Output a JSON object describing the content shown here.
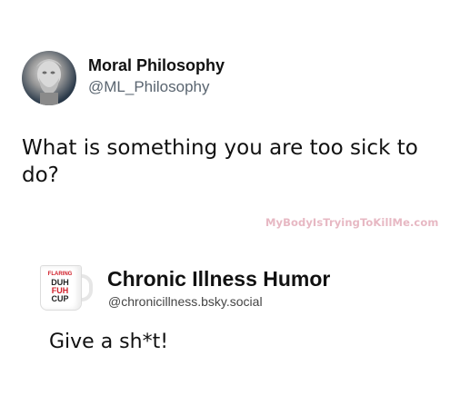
{
  "post1": {
    "author_name": "Moral Philosophy",
    "author_handle": "@ML_Philosophy",
    "text": "What is something you are too sick to do?",
    "avatar_icon": "statue-avatar-icon"
  },
  "watermark": {
    "text": "MyBodyIsTryingToKillMe.com"
  },
  "post2": {
    "author_name": "Chronic Illness Humor",
    "author_handle": "@chronicillness.bsky.social",
    "text": "Give a sh*t!",
    "avatar": {
      "icon": "mug-avatar-icon",
      "line1": "FLARING",
      "line2": "DUH",
      "line3": "FUH",
      "line4": "CUP"
    }
  },
  "colors": {
    "watermark": "#e7b8c3",
    "handle_gray": "#5a6570",
    "mug_red": "#d0202a"
  }
}
